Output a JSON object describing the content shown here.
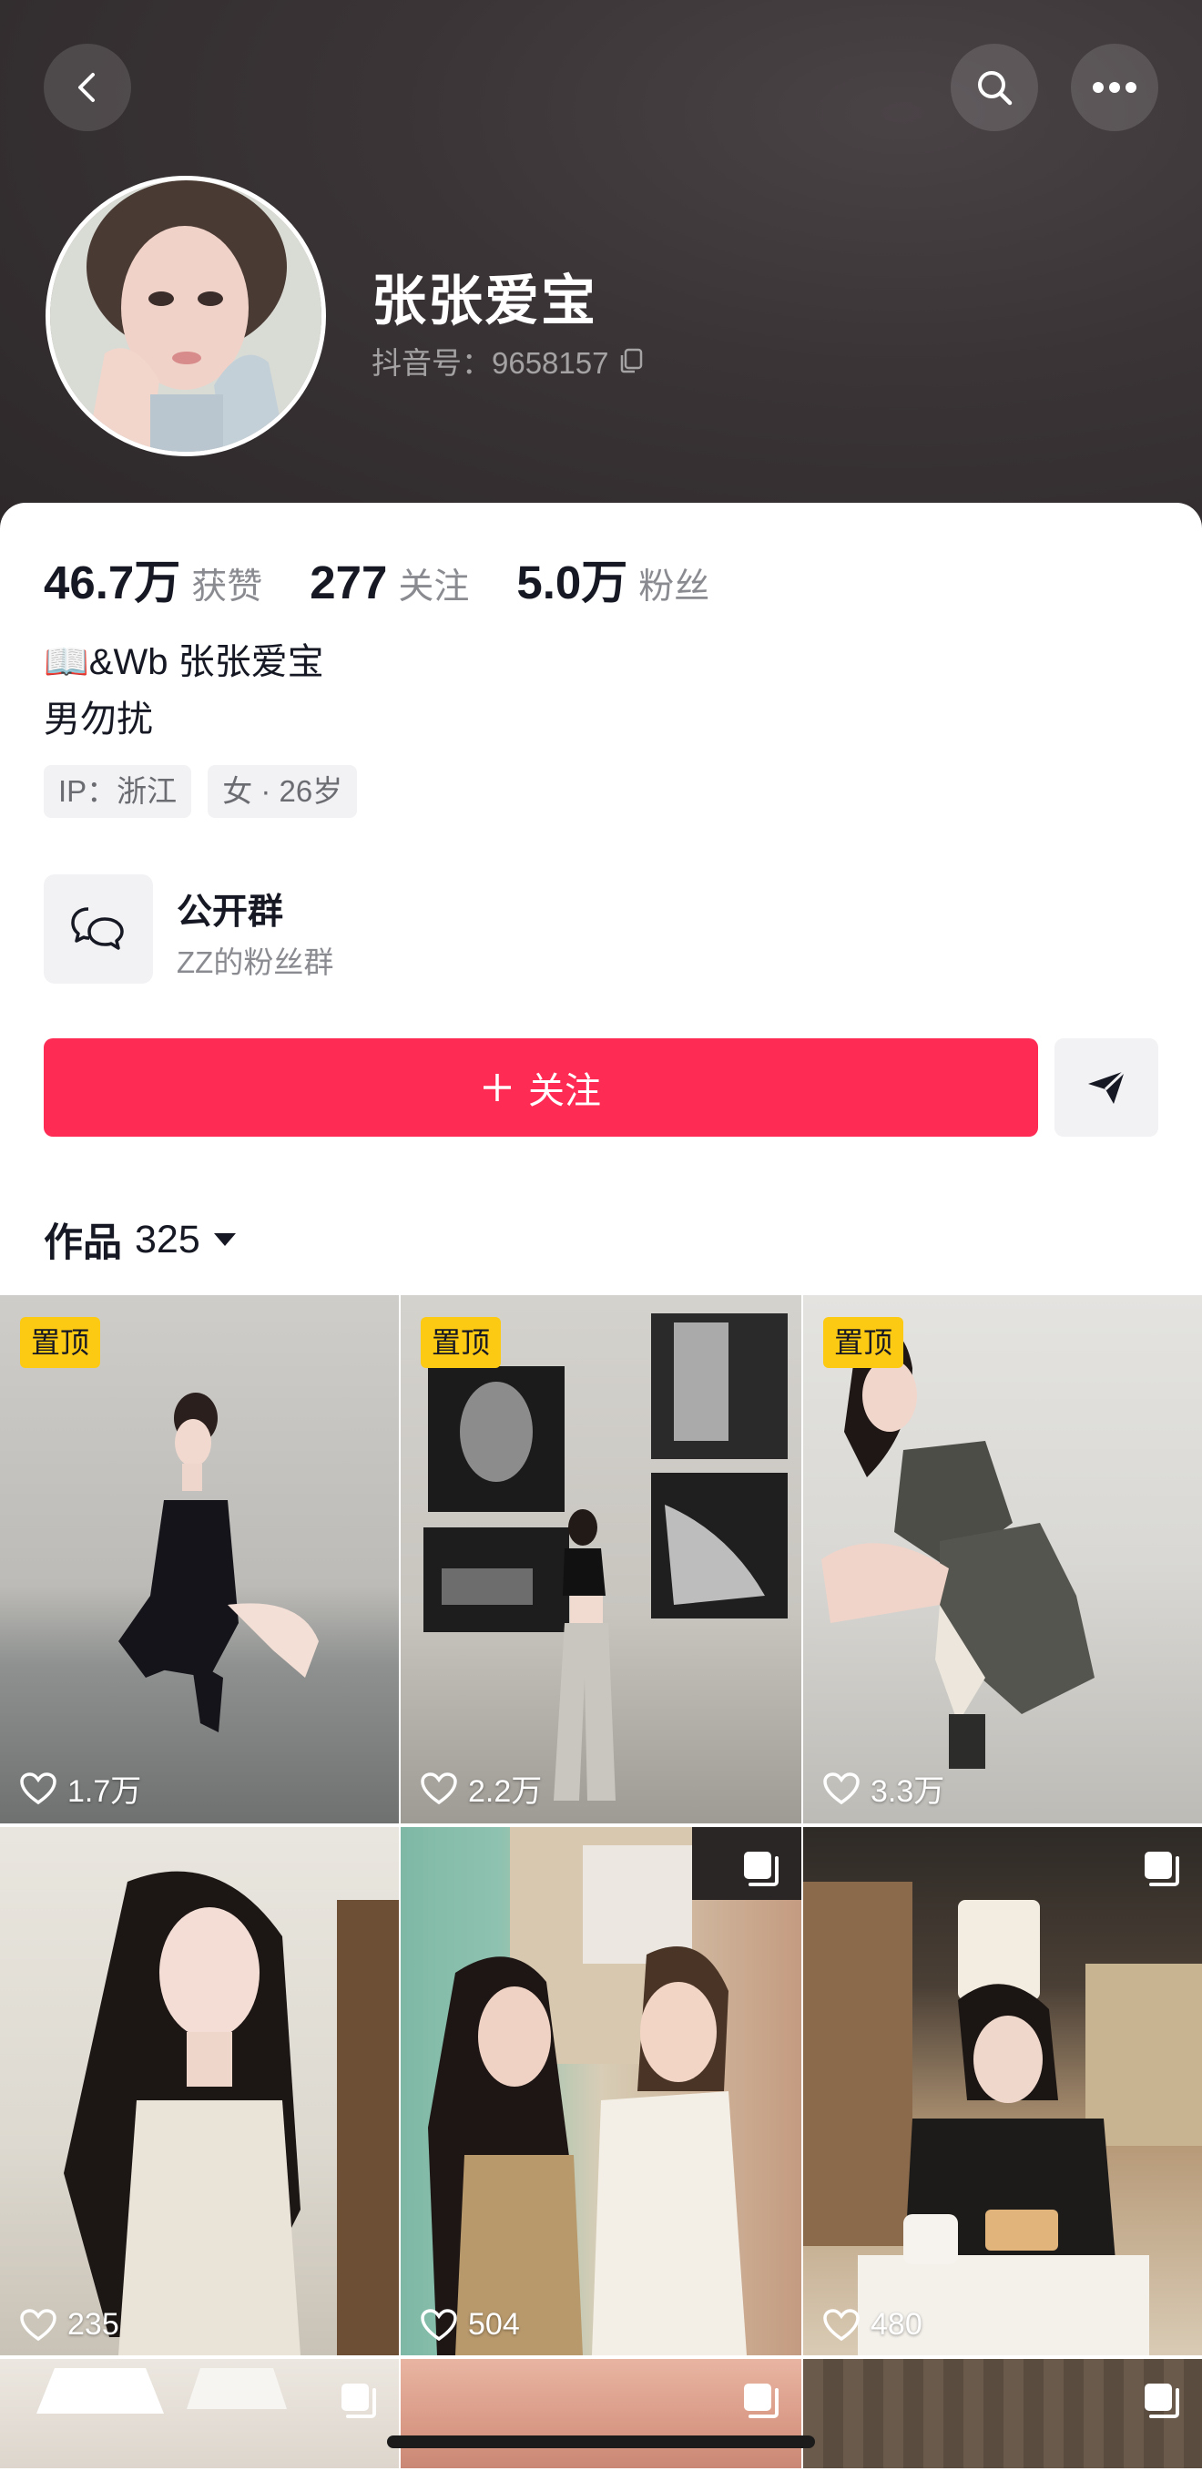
{
  "header": {
    "username": "张张爱宝",
    "douyin_id": "抖音号：9658157",
    "icons": [
      "back-icon",
      "search-icon",
      "more-icon",
      "copy-icon"
    ]
  },
  "stats": {
    "likes": {
      "value": "46.7万",
      "label": "获赞"
    },
    "following": {
      "value": "277",
      "label": "关注"
    },
    "followers": {
      "value": "5.0万",
      "label": "粉丝"
    }
  },
  "bio": {
    "line1": "📖&Wb 张张爱宝",
    "line2": "男勿扰"
  },
  "tags": {
    "ip": "IP：浙江",
    "gender_age": "女 · 26岁"
  },
  "group": {
    "title": "公开群",
    "subtitle": "ZZ的粉丝群"
  },
  "actions": {
    "follow_label": "关注",
    "accent": "#fe2c55"
  },
  "works": {
    "label": "作品",
    "count": "325"
  },
  "videos": [
    {
      "pinned": "置顶",
      "likes": "1.7万",
      "multi": false
    },
    {
      "pinned": "置顶",
      "likes": "2.2万",
      "multi": false
    },
    {
      "pinned": "置顶",
      "likes": "3.3万",
      "multi": false
    },
    {
      "pinned": "",
      "likes": "235",
      "multi": false
    },
    {
      "pinned": "",
      "likes": "504",
      "multi": true
    },
    {
      "pinned": "",
      "likes": "480",
      "multi": true
    }
  ]
}
